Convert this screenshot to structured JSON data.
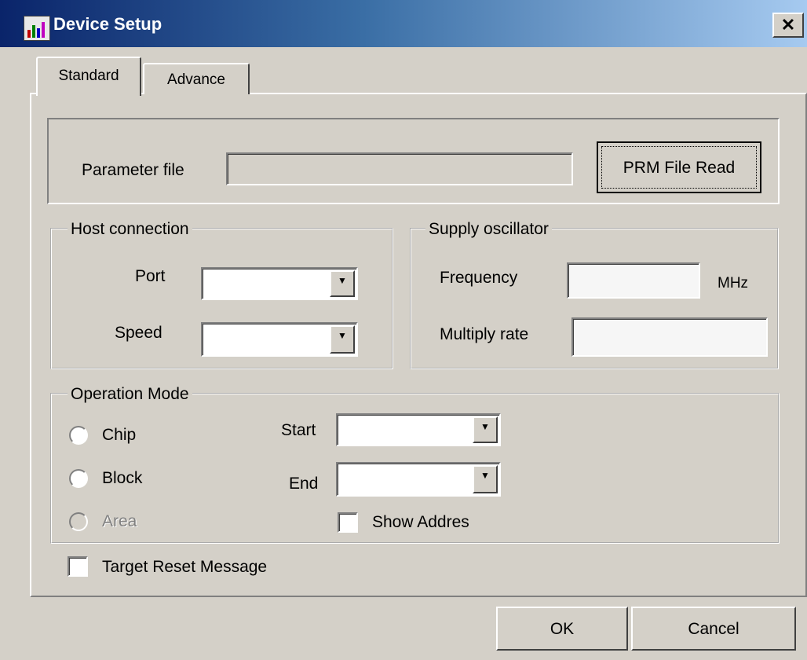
{
  "window": {
    "title": "Device Setup",
    "close_glyph": "✕"
  },
  "tabs": [
    {
      "label": "Standard",
      "selected": true
    },
    {
      "label": "Advance",
      "selected": false
    }
  ],
  "parameter": {
    "label": "Parameter file",
    "value": "",
    "read_button": "PRM File Read"
  },
  "host": {
    "title": "Host connection",
    "port_label": "Port",
    "port_value": "",
    "speed_label": "Speed",
    "speed_value": ""
  },
  "oscillator": {
    "title": "Supply oscillator",
    "frequency_label": "Frequency",
    "frequency_value": "",
    "frequency_unit": "MHz",
    "multiply_label": "Multiply rate",
    "multiply_value": ""
  },
  "operation": {
    "title": "Operation Mode",
    "modes": [
      {
        "label": "Chip",
        "enabled": true
      },
      {
        "label": "Block",
        "enabled": true
      },
      {
        "label": "Area",
        "enabled": false
      }
    ],
    "start_label": "Start",
    "start_value": "",
    "end_label": "End",
    "end_value": "",
    "show_address_label": "Show Addres",
    "show_address_checked": false
  },
  "target_reset": {
    "label": "Target Reset Message",
    "checked": false
  },
  "buttons": {
    "ok": "OK",
    "cancel": "Cancel"
  },
  "colors": {
    "titlebar_start": "#0a246a",
    "titlebar_end": "#a6caf0",
    "face": "#d4d0c8"
  },
  "icons": [
    "app-chart-icon",
    "close-icon",
    "chevron-down-icon"
  ]
}
